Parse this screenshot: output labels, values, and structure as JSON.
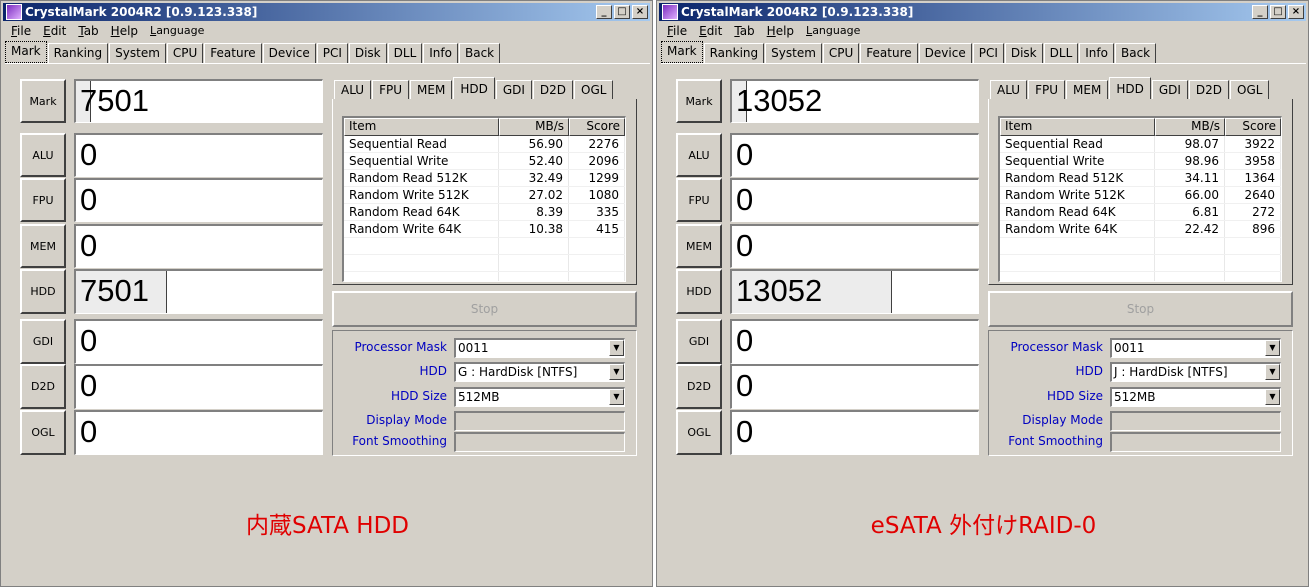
{
  "left": {
    "title": "CrystalMark 2004R2  [0.9.123.338]",
    "menus": [
      "File",
      "Edit",
      "Tab",
      "Help",
      "Language"
    ],
    "tabs": [
      "Mark",
      "Ranking",
      "System",
      "CPU",
      "Feature",
      "Device",
      "PCI",
      "Disk",
      "DLL",
      "Info",
      "Back"
    ],
    "scores": {
      "mark": "7501",
      "alu": "0",
      "fpu": "0",
      "mem": "0",
      "hdd": "7501",
      "gdi": "0",
      "d2d": "0",
      "ogl": "0"
    },
    "hdd_fill": 0.37,
    "subtabs": [
      "ALU",
      "FPU",
      "MEM",
      "HDD",
      "GDI",
      "D2D",
      "OGL"
    ],
    "table_headers": [
      "Item",
      "MB/s",
      "Score"
    ],
    "rows": [
      [
        "Sequential Read",
        "56.90",
        "2276"
      ],
      [
        "Sequential Write",
        "52.40",
        "2096"
      ],
      [
        "Random Read 512K",
        "32.49",
        "1299"
      ],
      [
        "Random Write 512K",
        "27.02",
        "1080"
      ],
      [
        "Random Read 64K",
        "8.39",
        "335"
      ],
      [
        "Random Write 64K",
        "10.38",
        "415"
      ]
    ],
    "stop_label": "Stop",
    "options": {
      "processor_mask_label": "Processor Mask",
      "processor_mask": "0011",
      "hdd_label": "HDD",
      "hdd": "G : HardDisk [NTFS]",
      "hdd_size_label": "HDD Size",
      "hdd_size": "512MB",
      "display_mode_label": "Display Mode",
      "font_smoothing_label": "Font Smoothing"
    },
    "caption": "内蔵SATA HDD"
  },
  "right": {
    "title": "CrystalMark 2004R2  [0.9.123.338]",
    "menus": [
      "File",
      "Edit",
      "Tab",
      "Help",
      "Language"
    ],
    "tabs": [
      "Mark",
      "Ranking",
      "System",
      "CPU",
      "Feature",
      "Device",
      "PCI",
      "Disk",
      "DLL",
      "Info",
      "Back"
    ],
    "scores": {
      "mark": "13052",
      "alu": "0",
      "fpu": "0",
      "mem": "0",
      "hdd": "13052",
      "gdi": "0",
      "d2d": "0",
      "ogl": "0"
    },
    "hdd_fill": 0.65,
    "subtabs": [
      "ALU",
      "FPU",
      "MEM",
      "HDD",
      "GDI",
      "D2D",
      "OGL"
    ],
    "table_headers": [
      "Item",
      "MB/s",
      "Score"
    ],
    "rows": [
      [
        "Sequential Read",
        "98.07",
        "3922"
      ],
      [
        "Sequential Write",
        "98.96",
        "3958"
      ],
      [
        "Random Read 512K",
        "34.11",
        "1364"
      ],
      [
        "Random Write 512K",
        "66.00",
        "2640"
      ],
      [
        "Random Read 64K",
        "6.81",
        "272"
      ],
      [
        "Random Write 64K",
        "22.42",
        "896"
      ]
    ],
    "stop_label": "Stop",
    "options": {
      "processor_mask_label": "Processor Mask",
      "processor_mask": "0011",
      "hdd_label": "HDD",
      "hdd": "J : HardDisk [NTFS]",
      "hdd_size_label": "HDD Size",
      "hdd_size": "512MB",
      "display_mode_label": "Display Mode",
      "font_smoothing_label": "Font Smoothing"
    },
    "caption": "eSATA 外付けRAID-0"
  }
}
